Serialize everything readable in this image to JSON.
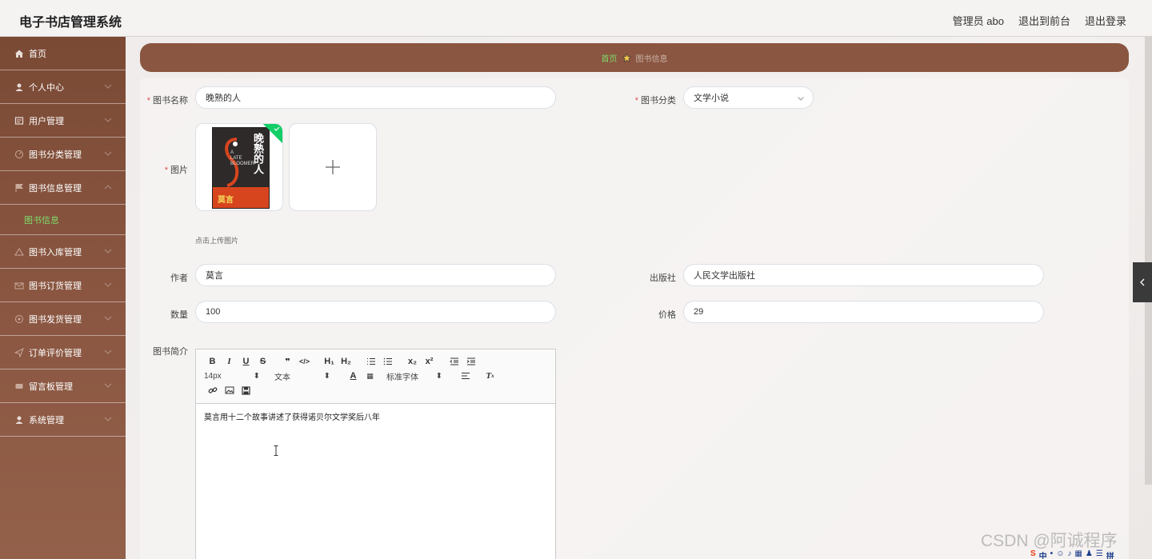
{
  "header": {
    "title": "电子书店管理系统",
    "user_label": "管理员 abo",
    "front_label": "退出到前台",
    "logout_label": "退出登录"
  },
  "sidebar": {
    "items": [
      {
        "label": "首页",
        "icon": "home-icon"
      },
      {
        "label": "个人中心",
        "icon": "user-icon"
      },
      {
        "label": "用户管理",
        "icon": "users-icon"
      },
      {
        "label": "图书分类管理",
        "icon": "category-icon"
      },
      {
        "label": "图书信息管理",
        "icon": "flag-icon",
        "expanded": true
      },
      {
        "label": "图书入库管理",
        "icon": "warehouse-icon"
      },
      {
        "label": "图书订货管理",
        "icon": "order-icon"
      },
      {
        "label": "图书发货管理",
        "icon": "shipping-icon"
      },
      {
        "label": "订单评价管理",
        "icon": "review-icon"
      },
      {
        "label": "留言板管理",
        "icon": "message-icon"
      },
      {
        "label": "系统管理",
        "icon": "system-icon"
      }
    ],
    "sub_items": [
      "图书信息"
    ]
  },
  "breadcrumb": {
    "home": "首页",
    "current": "图书信息"
  },
  "form": {
    "name_label": "图书名称",
    "name_value": "晚熟的人",
    "category_label": "图书分类",
    "category_value": "文学小说",
    "image_label": "图片",
    "upload_tip": "点击上传图片",
    "author_label": "作者",
    "author_value": "莫言",
    "publisher_label": "出版社",
    "publisher_value": "人民文学出版社",
    "quantity_label": "数量",
    "quantity_value": "100",
    "price_label": "价格",
    "price_value": "29",
    "intro_label": "图书简介"
  },
  "book_cover": {
    "title": "晚熟的人",
    "subtitle_lines": [
      "A",
      "LATE",
      "BLOOMER"
    ],
    "author": "莫言"
  },
  "editor": {
    "size_picker": "14px",
    "header_picker": "文本",
    "font_picker": "标准字体",
    "content": "莫言用十二个故事讲述了获得诺贝尔文学奖后八年"
  },
  "watermark": "CSDN @阿诚程序",
  "tray": [
    "S",
    "中",
    "•",
    "☺",
    "♪",
    "▦",
    "♟",
    "☰",
    "拼"
  ],
  "colors": {
    "sidebar": "#8a5641",
    "active": "#7fdc6a",
    "success": "#13ce66"
  }
}
